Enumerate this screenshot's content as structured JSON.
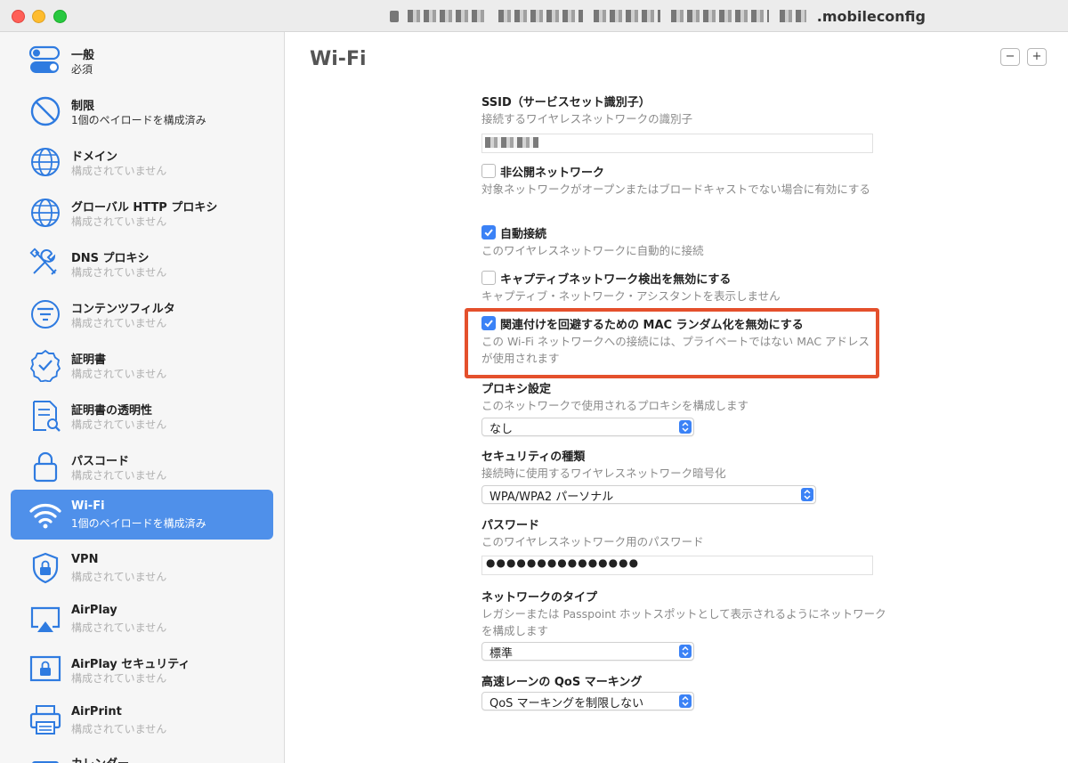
{
  "window": {
    "title": ".mobileconfig"
  },
  "sidebar": {
    "items": [
      {
        "title": "一般",
        "subtitle": "必須",
        "icon": "toggle-icon"
      },
      {
        "title": "制限",
        "subtitle": "1個のペイロードを構成済み",
        "icon": "prohibited-icon"
      },
      {
        "title": "ドメイン",
        "subtitle": "構成されていません",
        "icon": "globe-icon"
      },
      {
        "title": "グローバル HTTP プロキシ",
        "subtitle": "構成されていません",
        "icon": "globe-icon"
      },
      {
        "title": "DNS プロキシ",
        "subtitle": "構成されていません",
        "icon": "tools-icon"
      },
      {
        "title": "コンテンツフィルタ",
        "subtitle": "構成されていません",
        "icon": "filter-icon"
      },
      {
        "title": "証明書",
        "subtitle": "構成されていません",
        "icon": "certificate-badge-icon"
      },
      {
        "title": "証明書の透明性",
        "subtitle": "構成されていません",
        "icon": "document-search-icon"
      },
      {
        "title": "パスコード",
        "subtitle": "構成されていません",
        "icon": "lock-icon"
      },
      {
        "title": "Wi-Fi",
        "subtitle": "1個のペイロードを構成済み",
        "icon": "wifi-icon"
      },
      {
        "title": "VPN",
        "subtitle": "構成されていません",
        "icon": "shield-lock-icon"
      },
      {
        "title": "AirPlay",
        "subtitle": "構成されていません",
        "icon": "airplay-icon"
      },
      {
        "title": "AirPlay セキュリティ",
        "subtitle": "構成されていません",
        "icon": "screen-lock-icon"
      },
      {
        "title": "AirPrint",
        "subtitle": "構成されていません",
        "icon": "printer-icon"
      },
      {
        "title": "カレンダー",
        "subtitle": "",
        "icon": "calendar-icon"
      }
    ]
  },
  "main": {
    "title": "Wi-Fi",
    "minus_label": "−",
    "plus_label": "+",
    "ssid": {
      "label": "SSID（サービスセット識別子）",
      "description": "接続するワイヤレスネットワークの識別子"
    },
    "hidden_network": {
      "label": "非公開ネットワーク",
      "checked": false,
      "description": "対象ネットワークがオープンまたはブロードキャストでない場合に有効にする"
    },
    "auto_join": {
      "label": "自動接続",
      "checked": true,
      "description": "このワイヤレスネットワークに自動的に接続"
    },
    "captive": {
      "label": "キャプティブネットワーク検出を無効にする",
      "checked": false,
      "description": "キャプティブ・ネットワーク・アシスタントを表示しません"
    },
    "mac_random": {
      "label": "関連付けを回避するための MAC ランダム化を無効にする",
      "checked": true,
      "description": "この Wi-Fi ネットワークへの接続には、プライベートではない MAC アドレスが使用されます"
    },
    "proxy": {
      "label": "プロキシ設定",
      "description": "このネットワークで使用されるプロキシを構成します",
      "value": "なし"
    },
    "security": {
      "label": "セキュリティの種類",
      "description": "接続時に使用するワイヤレスネットワーク暗号化",
      "value": "WPA/WPA2 パーソナル"
    },
    "password": {
      "label": "パスワード",
      "description": "このワイヤレスネットワーク用のパスワード",
      "value": "●●●●●●●●●●●●●●●"
    },
    "network_type": {
      "label": "ネットワークのタイプ",
      "description": "レガシーまたは Passpoint ホットスポットとして表示されるようにネットワークを構成します",
      "value": "標準"
    },
    "qos": {
      "label": "高速レーンの QoS マーキング",
      "value": "QoS マーキングを制限しない"
    }
  },
  "colors": {
    "accent": "#3b82f6",
    "selection": "#4f90ea",
    "highlight_border": "#e4502c"
  }
}
